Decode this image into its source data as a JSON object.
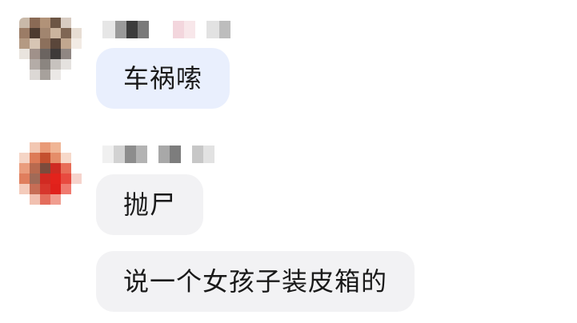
{
  "messages": [
    {
      "sender": "redacted",
      "text": "车祸嗦"
    },
    {
      "sender": "redacted",
      "text": "抛尸"
    },
    {
      "sender": "redacted",
      "text": "说一个女孩子装皮箱的"
    }
  ],
  "colors": {
    "bubble_self_blue": "#e9effd",
    "bubble_gray": "#f2f2f4"
  }
}
